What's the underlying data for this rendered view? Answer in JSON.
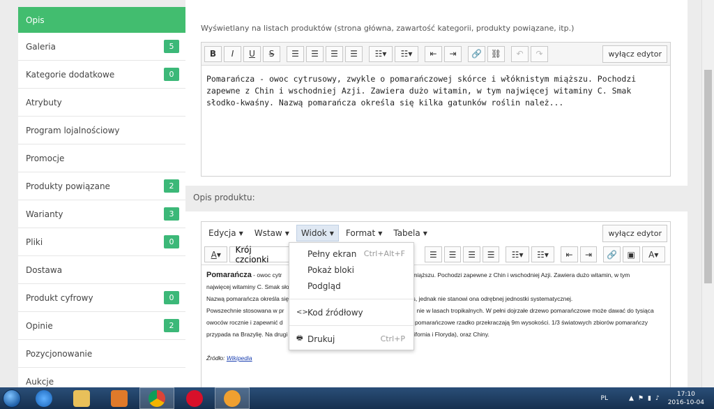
{
  "sidebar": {
    "items": [
      {
        "label": "Opis",
        "badge": "",
        "active": true
      },
      {
        "label": "Galeria",
        "badge": "5"
      },
      {
        "label": "Kategorie dodatkowe",
        "badge": "0"
      },
      {
        "label": "Atrybuty",
        "badge": ""
      },
      {
        "label": "Program lojalnościowy",
        "badge": ""
      },
      {
        "label": "Promocje",
        "badge": ""
      },
      {
        "label": "Produkty powiązane",
        "badge": "2"
      },
      {
        "label": "Warianty",
        "badge": "3"
      },
      {
        "label": "Pliki",
        "badge": "0"
      },
      {
        "label": "Dostawa",
        "badge": ""
      },
      {
        "label": "Produkt cyfrowy",
        "badge": "0"
      },
      {
        "label": "Opinie",
        "badge": "2"
      },
      {
        "label": "Pozycjonowanie",
        "badge": ""
      },
      {
        "label": "Aukcje",
        "badge": ""
      }
    ]
  },
  "short_desc": {
    "hint": "Wyświetlany na listach produktów (strona główna, zawartość kategorii, produkty powiązane, itp.)",
    "toggle_label": "wyłącz edytor",
    "content": "Pomarańcza - owoc cytrusowy, zwykle o pomarańczowej skórce i włóknistym miąższu. Pochodzi zapewne z Chin i wschodniej Azji. Zawiera dużo witamin, w tym najwięcej witaminy C. Smak słodko-kwaśny. Nazwą pomarańcza określa się kilka gatunków roślin należ..."
  },
  "long_desc": {
    "section_label": "Opis produktu:",
    "menu": [
      "Edycja",
      "Wstaw",
      "Widok",
      "Format",
      "Tabela"
    ],
    "toggle_label": "wyłącz edytor",
    "font_select": "Krój czcionki",
    "content": {
      "title": "Pomarańcza",
      "p1a": " - owoc cytr",
      "p1b": "knistym miąższu. Pochodzi zapewne z Chin i wschodniej Azji. Zawiera dużo witamin, w tym",
      "p2a": "najwięcej witaminy C. Smak sło",
      "p3a": "Nazwą pomarańcza określa się",
      "p3b": "rus, jednak nie stanowi ona odrębnej jednostki systematycznej.",
      "p4a": "Powszechnie stosowana w pr",
      "p4b": "nie w lasach tropikalnych. W pełni dojrzałe drzewo pomarańczowe może dawać do tysiąca",
      "p5a": "owoców rocznie i zapewnić d",
      "p5b": "ka pomarańczowe rzadko przekraczają 9m wysokości. 1/3 światowych zbiorów pomarańczy",
      "p6a": "przypada na Brazylię. Na drugi",
      "p6b": "alifornia i Floryda), oraz Chiny.",
      "source_label": "Źródło:",
      "source_link": "Wikipedia"
    }
  },
  "view_menu": {
    "items": [
      {
        "label": "Pełny ekran",
        "shortcut": "Ctrl+Alt+F"
      },
      {
        "label": "Pokaż bloki",
        "shortcut": ""
      },
      {
        "label": "Podgląd",
        "shortcut": ""
      },
      {
        "label": "Kod źródłowy",
        "shortcut": ""
      },
      {
        "label": "Drukuj",
        "shortcut": "Ctrl+P"
      }
    ]
  },
  "taskbar": {
    "lang": "PL",
    "time": "17:10",
    "date": "2016-10-04"
  },
  "colors": {
    "accent": "#42bd6f",
    "badge": "#3cb878"
  }
}
